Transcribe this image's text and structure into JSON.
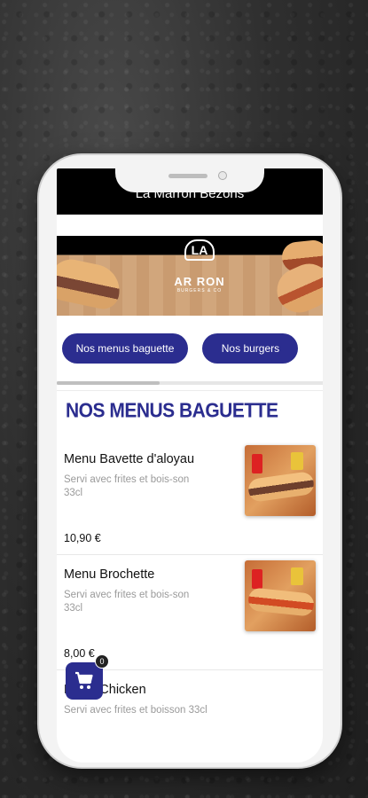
{
  "app": {
    "title": "La Marron Bezons"
  },
  "banner": {
    "logo_top": "LA",
    "logo_name": "AR RON",
    "logo_sub": "BURGERS & CO"
  },
  "categories": [
    {
      "label": "Nos menus baguette",
      "selected": true
    },
    {
      "label": "Nos burgers",
      "selected": false
    }
  ],
  "section": {
    "title": "NOS MENUS BAGUETTE"
  },
  "items": [
    {
      "name": "Menu Bavette d'aloyau",
      "description": "Servi avec frites et bois-son 33cl",
      "price": "10,90 €"
    },
    {
      "name": "Menu Brochette",
      "description": "Servi avec frites et bois-son 33cl",
      "price": "8,00 €"
    },
    {
      "name": "Menu Chicken",
      "description": "Servi avec frites et boisson 33cl",
      "price": ""
    }
  ],
  "cart": {
    "count": "0",
    "icon": "cart-icon"
  },
  "colors": {
    "accent": "#2b2d8f",
    "header": "#000000"
  }
}
